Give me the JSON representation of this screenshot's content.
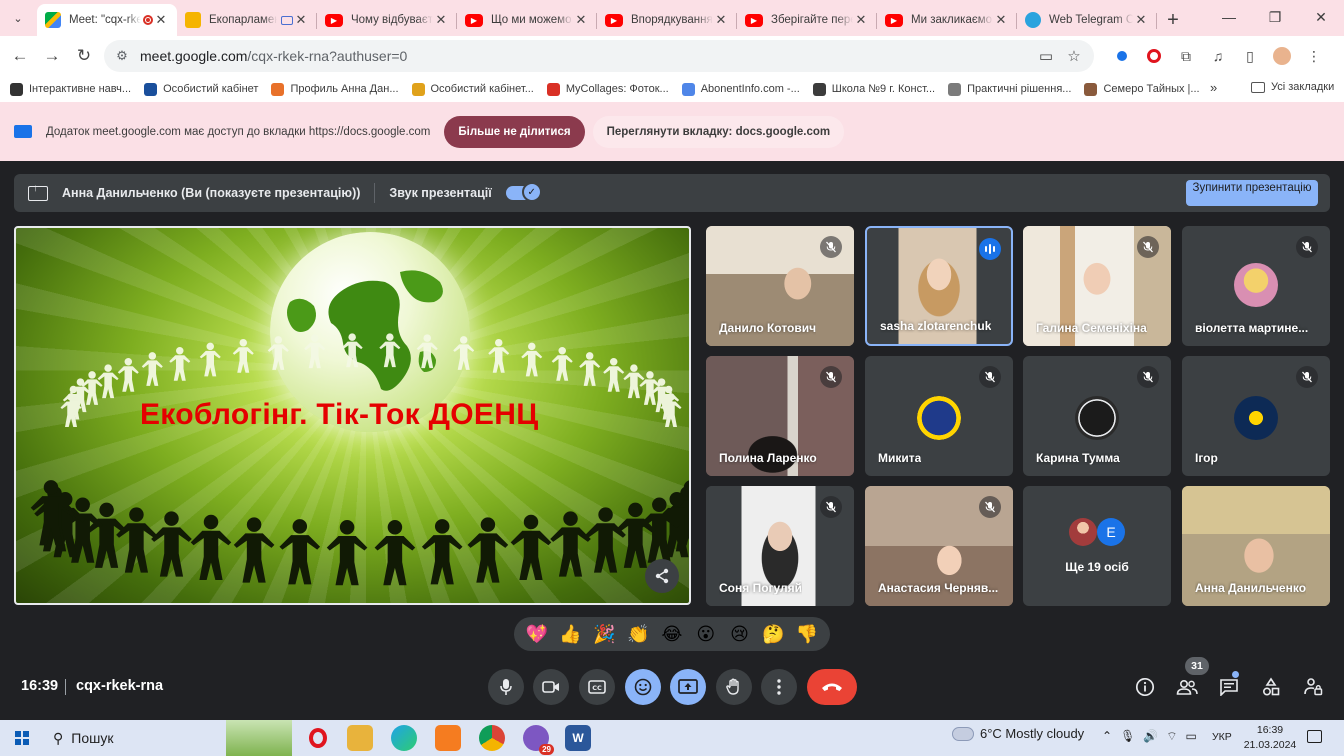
{
  "browser": {
    "tabs": [
      {
        "label": "Meet: \"cqx-rkek-rna\"",
        "favicon": "google-meet-icon",
        "active": true
      },
      {
        "label": "Екопарламент",
        "favicon": "google-slides-icon",
        "active": false
      },
      {
        "label": "Чому відбувається",
        "favicon": "youtube-icon",
        "active": false
      },
      {
        "label": "Що ми можемо",
        "favicon": "youtube-icon",
        "active": false
      },
      {
        "label": "Впорядкування",
        "favicon": "youtube-icon",
        "active": false
      },
      {
        "label": "Зберігайте пере",
        "favicon": "youtube-icon",
        "active": false
      },
      {
        "label": "Ми закликаємо",
        "favicon": "youtube-icon",
        "active": false
      },
      {
        "label": "Web Telegram C",
        "favicon": "telegram-icon",
        "active": false
      }
    ],
    "url_host": "meet.google.com",
    "url_path": "/cqx-rkek-rna?authuser=0",
    "bookmarks": [
      {
        "label": "Інтерактивне навч...",
        "color": "#333333"
      },
      {
        "label": "Особистий кабінет",
        "color": "#1a4f9c"
      },
      {
        "label": "Профиль Анна Дан...",
        "color": "#e8712a"
      },
      {
        "label": "Особистий кабінет...",
        "color": "#e0a21b"
      },
      {
        "label": "MyCollages: Фоток...",
        "color": "#d93025"
      },
      {
        "label": "AbonentInfo.com -...",
        "color": "#4f86e8"
      },
      {
        "label": "Школа №9 г. Конст...",
        "color": "#3c3c3c"
      },
      {
        "label": "Практичні рішення...",
        "color": "#7b7b7b"
      },
      {
        "label": "Семеро Тайных |...",
        "color": "#8a5a3c"
      }
    ],
    "bookmarks_all": "Усі закладки"
  },
  "infobar": {
    "text": "Додаток meet.google.com має доступ до вкладки https://docs.google.com",
    "stop_sharing": "Більше не ділитися",
    "view_tab": "Переглянути вкладку: docs.google.com"
  },
  "presenting": {
    "name": "Анна Данильченко (Ви (показуєте презентацію))",
    "audio_label": "Звук презентації",
    "audio_on": true,
    "stop_label": "Зупинити презентацію"
  },
  "slide": {
    "title": "Екоблогінг. Тік-Ток ДОЕНЦ"
  },
  "participants": [
    {
      "name": "Данило Котович",
      "muted": true,
      "bg": "#b9a88f"
    },
    {
      "name": "sasha zlotarenchuk",
      "muted": false,
      "speaking": true,
      "bg": "#c9b49a"
    },
    {
      "name": "Галина Семеніхіна",
      "muted": true,
      "bg": "#d8cdb8"
    },
    {
      "name": "віолетта мартине...",
      "muted": true,
      "bg": "#3c4043"
    },
    {
      "name": "Полина Ларенко",
      "muted": true,
      "bg": "#6b5a55"
    },
    {
      "name": "Микита",
      "muted": true,
      "bg": "#3c4043"
    },
    {
      "name": "Карина Тумма",
      "muted": true,
      "bg": "#3c4043"
    },
    {
      "name": "Ігор",
      "muted": true,
      "bg": "#3c4043"
    },
    {
      "name": "Соня Погуляй",
      "muted": true,
      "bg": "#3c4043"
    },
    {
      "name": "Анастасия Черняв...",
      "muted": true,
      "bg": "#a08a78"
    },
    {
      "name": "Ще 19 осіб",
      "muted": false,
      "bg": "#3c4043"
    },
    {
      "name": "Анна Данильченко",
      "muted": false,
      "bg": "#b6a77e"
    }
  ],
  "more_avatar_letter": "E",
  "reactions": [
    "💖",
    "👍",
    "🎉",
    "👏",
    "😂",
    "😮",
    "😢",
    "🤔",
    "👎"
  ],
  "call": {
    "time": "16:39",
    "meeting_code": "cqx-rkek-rna",
    "people_count": "31"
  },
  "taskbar": {
    "search": "Пошук",
    "weather": "6°C  Mostly cloudy",
    "lang": "УКР",
    "time": "16:39",
    "date": "21.03.2024",
    "viber_badge": "29"
  },
  "colors": {
    "meet_bg": "#202124",
    "tile_bg": "#3c4043",
    "accent_blue": "#8ab4f8",
    "end_call_red": "#ea4335",
    "chrome_frame": "#fbe0e6"
  }
}
